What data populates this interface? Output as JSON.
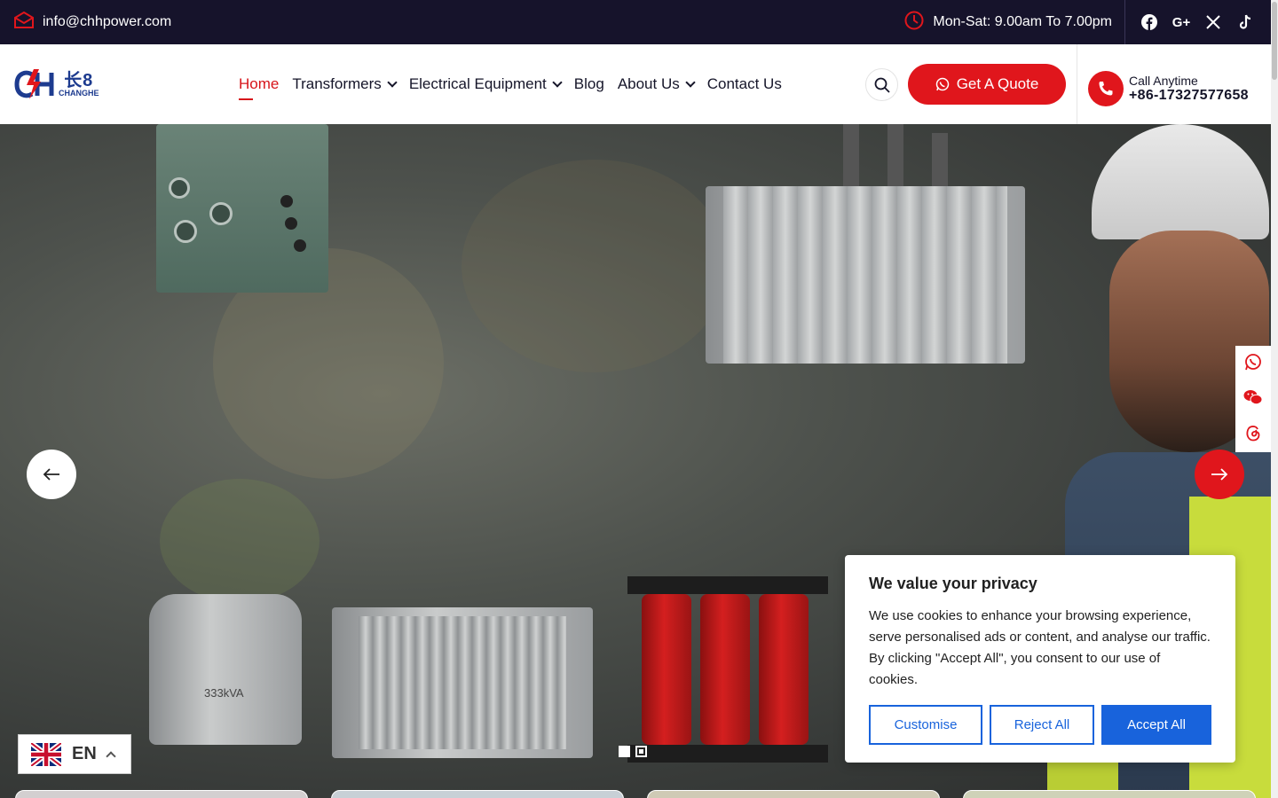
{
  "topbar": {
    "email": "info@chhpower.com",
    "hours": "Mon-Sat: 9.00am To 7.00pm",
    "socials": [
      "facebook-icon",
      "google-plus-icon",
      "x-icon",
      "tiktok-icon"
    ]
  },
  "logo": {
    "brand_cn": "长8",
    "brand": "CHANGHE"
  },
  "nav": {
    "items": [
      {
        "label": "Home"
      },
      {
        "label": "Transformers"
      },
      {
        "label": "Electrical Equipment"
      },
      {
        "label": "Blog"
      },
      {
        "label": "About Us"
      },
      {
        "label": "Contact Us"
      }
    ]
  },
  "header": {
    "quote_label": "Get A Quote",
    "call_label": "Call Anytime",
    "call_number": "+86-17327577658"
  },
  "hero": {
    "tx_label": "333kVA"
  },
  "cookie": {
    "title": "We value your privacy",
    "body": "We use cookies to enhance your browsing experience, serve personalised ads or content, and analyse our traffic. By clicking \"Accept All\", you consent to our use of cookies.",
    "customise": "Customise",
    "reject": "Reject All",
    "accept": "Accept All"
  },
  "language": {
    "code": "EN"
  },
  "colors": {
    "accent": "#e0161c",
    "topbar": "#16132b",
    "cookie_blue": "#1863dc"
  }
}
